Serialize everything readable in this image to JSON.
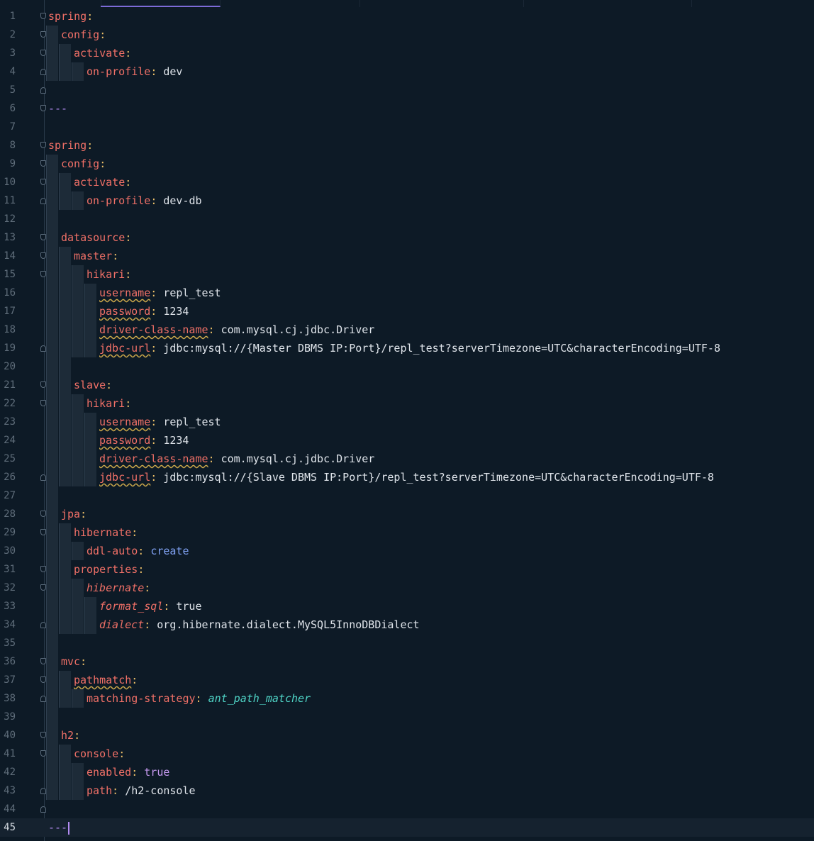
{
  "editor": {
    "language": "yaml",
    "current_line": 45,
    "accent_color": "#7c6bd8",
    "lines": [
      {
        "n": "1",
        "indent": 0,
        "fold": "down",
        "segs": [
          {
            "t": "spring",
            "c": "k"
          },
          {
            "t": ":",
            "c": "p"
          }
        ]
      },
      {
        "n": "2",
        "indent": 1,
        "fold": "down",
        "segs": [
          {
            "t": "config",
            "c": "k"
          },
          {
            "t": ":",
            "c": "p"
          }
        ]
      },
      {
        "n": "3",
        "indent": 2,
        "fold": "down",
        "segs": [
          {
            "t": "activate",
            "c": "k"
          },
          {
            "t": ":",
            "c": "p"
          }
        ]
      },
      {
        "n": "4",
        "indent": 3,
        "fold": "up",
        "segs": [
          {
            "t": "on-profile",
            "c": "k"
          },
          {
            "t": ": ",
            "c": "p"
          },
          {
            "t": "dev",
            "c": "v"
          }
        ]
      },
      {
        "n": "5",
        "indent": 0,
        "fold": "up",
        "segs": []
      },
      {
        "n": "6",
        "indent": 0,
        "fold": "down",
        "segs": [
          {
            "t": "---",
            "c": "sep"
          }
        ]
      },
      {
        "n": "7",
        "indent": 0,
        "fold": "",
        "segs": []
      },
      {
        "n": "8",
        "indent": 0,
        "fold": "down",
        "segs": [
          {
            "t": "spring",
            "c": "k"
          },
          {
            "t": ":",
            "c": "p"
          }
        ]
      },
      {
        "n": "9",
        "indent": 1,
        "fold": "down",
        "segs": [
          {
            "t": "config",
            "c": "k"
          },
          {
            "t": ":",
            "c": "p"
          }
        ]
      },
      {
        "n": "10",
        "indent": 2,
        "fold": "down",
        "segs": [
          {
            "t": "activate",
            "c": "k"
          },
          {
            "t": ":",
            "c": "p"
          }
        ]
      },
      {
        "n": "11",
        "indent": 3,
        "fold": "up",
        "segs": [
          {
            "t": "on-profile",
            "c": "k"
          },
          {
            "t": ": ",
            "c": "p"
          },
          {
            "t": "dev-db",
            "c": "v"
          }
        ]
      },
      {
        "n": "12",
        "indent": 1,
        "fold": "",
        "segs": []
      },
      {
        "n": "13",
        "indent": 1,
        "fold": "down",
        "segs": [
          {
            "t": "datasource",
            "c": "k"
          },
          {
            "t": ":",
            "c": "p"
          }
        ]
      },
      {
        "n": "14",
        "indent": 2,
        "fold": "down",
        "segs": [
          {
            "t": "master",
            "c": "k"
          },
          {
            "t": ":",
            "c": "p"
          }
        ]
      },
      {
        "n": "15",
        "indent": 3,
        "fold": "down",
        "segs": [
          {
            "t": "hikari",
            "c": "k"
          },
          {
            "t": ":",
            "c": "p"
          }
        ]
      },
      {
        "n": "16",
        "indent": 4,
        "fold": "",
        "segs": [
          {
            "t": "username",
            "c": "k sq"
          },
          {
            "t": ": ",
            "c": "p"
          },
          {
            "t": "repl_test",
            "c": "v"
          }
        ]
      },
      {
        "n": "17",
        "indent": 4,
        "fold": "",
        "segs": [
          {
            "t": "password",
            "c": "k sq"
          },
          {
            "t": ": ",
            "c": "p"
          },
          {
            "t": "1234",
            "c": "v"
          }
        ]
      },
      {
        "n": "18",
        "indent": 4,
        "fold": "",
        "segs": [
          {
            "t": "driver-class-name",
            "c": "k sq"
          },
          {
            "t": ": ",
            "c": "p"
          },
          {
            "t": "com.mysql.cj.jdbc.Driver",
            "c": "v"
          }
        ]
      },
      {
        "n": "19",
        "indent": 4,
        "fold": "up",
        "segs": [
          {
            "t": "jdbc-url",
            "c": "k sq"
          },
          {
            "t": ": ",
            "c": "p"
          },
          {
            "t": "jdbc:mysql://{Master DBMS IP:Port}/repl_test?serverTimezone=UTC&characterEncoding=UTF-8",
            "c": "v"
          }
        ]
      },
      {
        "n": "20",
        "indent": 2,
        "fold": "",
        "segs": []
      },
      {
        "n": "21",
        "indent": 2,
        "fold": "down",
        "segs": [
          {
            "t": "slave",
            "c": "k"
          },
          {
            "t": ":",
            "c": "p"
          }
        ]
      },
      {
        "n": "22",
        "indent": 3,
        "fold": "down",
        "segs": [
          {
            "t": "hikari",
            "c": "k"
          },
          {
            "t": ":",
            "c": "p"
          }
        ]
      },
      {
        "n": "23",
        "indent": 4,
        "fold": "",
        "segs": [
          {
            "t": "username",
            "c": "k sq"
          },
          {
            "t": ": ",
            "c": "p"
          },
          {
            "t": "repl_test",
            "c": "v"
          }
        ]
      },
      {
        "n": "24",
        "indent": 4,
        "fold": "",
        "segs": [
          {
            "t": "password",
            "c": "k sq"
          },
          {
            "t": ": ",
            "c": "p"
          },
          {
            "t": "1234",
            "c": "v"
          }
        ]
      },
      {
        "n": "25",
        "indent": 4,
        "fold": "",
        "segs": [
          {
            "t": "driver-class-name",
            "c": "k sq"
          },
          {
            "t": ": ",
            "c": "p"
          },
          {
            "t": "com.mysql.cj.jdbc.Driver",
            "c": "v"
          }
        ]
      },
      {
        "n": "26",
        "indent": 4,
        "fold": "up",
        "segs": [
          {
            "t": "jdbc-url",
            "c": "k sq"
          },
          {
            "t": ": ",
            "c": "p"
          },
          {
            "t": "jdbc:mysql://{Slave DBMS IP:Port}/repl_test?serverTimezone=UTC&characterEncoding=UTF-8",
            "c": "v"
          }
        ]
      },
      {
        "n": "27",
        "indent": 1,
        "fold": "",
        "segs": []
      },
      {
        "n": "28",
        "indent": 1,
        "fold": "down",
        "segs": [
          {
            "t": "jpa",
            "c": "k"
          },
          {
            "t": ":",
            "c": "p"
          }
        ]
      },
      {
        "n": "29",
        "indent": 2,
        "fold": "down",
        "segs": [
          {
            "t": "hibernate",
            "c": "k"
          },
          {
            "t": ":",
            "c": "p"
          }
        ]
      },
      {
        "n": "30",
        "indent": 3,
        "fold": "",
        "segs": [
          {
            "t": "ddl-auto",
            "c": "k"
          },
          {
            "t": ": ",
            "c": "p"
          },
          {
            "t": "create",
            "c": "b"
          }
        ]
      },
      {
        "n": "31",
        "indent": 2,
        "fold": "down",
        "segs": [
          {
            "t": "properties",
            "c": "k"
          },
          {
            "t": ":",
            "c": "p"
          }
        ]
      },
      {
        "n": "32",
        "indent": 3,
        "fold": "down",
        "segs": [
          {
            "t": "hibernate",
            "c": "k it"
          },
          {
            "t": ":",
            "c": "p"
          }
        ]
      },
      {
        "n": "33",
        "indent": 4,
        "fold": "",
        "segs": [
          {
            "t": "format_sql",
            "c": "k it"
          },
          {
            "t": ": ",
            "c": "p"
          },
          {
            "t": "true",
            "c": "v"
          }
        ]
      },
      {
        "n": "34",
        "indent": 4,
        "fold": "up",
        "segs": [
          {
            "t": "dialect",
            "c": "k it"
          },
          {
            "t": ": ",
            "c": "p"
          },
          {
            "t": "org.hibernate.dialect.MySQL5InnoDBDialect",
            "c": "v"
          }
        ]
      },
      {
        "n": "35",
        "indent": 1,
        "fold": "",
        "segs": []
      },
      {
        "n": "36",
        "indent": 1,
        "fold": "down",
        "segs": [
          {
            "t": "mvc",
            "c": "k"
          },
          {
            "t": ":",
            "c": "p"
          }
        ]
      },
      {
        "n": "37",
        "indent": 2,
        "fold": "down",
        "segs": [
          {
            "t": "pathmatch",
            "c": "k sq"
          },
          {
            "t": ":",
            "c": "p"
          }
        ]
      },
      {
        "n": "38",
        "indent": 3,
        "fold": "up",
        "segs": [
          {
            "t": "matching-strategy",
            "c": "k"
          },
          {
            "t": ": ",
            "c": "p"
          },
          {
            "t": "ant_path_matcher",
            "c": "i"
          }
        ]
      },
      {
        "n": "39",
        "indent": 1,
        "fold": "",
        "segs": []
      },
      {
        "n": "40",
        "indent": 1,
        "fold": "down",
        "segs": [
          {
            "t": "h2",
            "c": "k"
          },
          {
            "t": ":",
            "c": "p"
          }
        ]
      },
      {
        "n": "41",
        "indent": 2,
        "fold": "down",
        "segs": [
          {
            "t": "console",
            "c": "k"
          },
          {
            "t": ":",
            "c": "p"
          }
        ]
      },
      {
        "n": "42",
        "indent": 3,
        "fold": "",
        "segs": [
          {
            "t": "enabled",
            "c": "k"
          },
          {
            "t": ": ",
            "c": "p"
          },
          {
            "t": "true",
            "c": "t"
          }
        ]
      },
      {
        "n": "43",
        "indent": 3,
        "fold": "up",
        "segs": [
          {
            "t": "path",
            "c": "k"
          },
          {
            "t": ": ",
            "c": "p"
          },
          {
            "t": "/h2-console",
            "c": "v"
          }
        ]
      },
      {
        "n": "44",
        "indent": 0,
        "fold": "up",
        "segs": []
      },
      {
        "n": "45",
        "indent": 0,
        "fold": "",
        "segs": [
          {
            "t": "---",
            "c": "sep"
          }
        ]
      }
    ]
  }
}
